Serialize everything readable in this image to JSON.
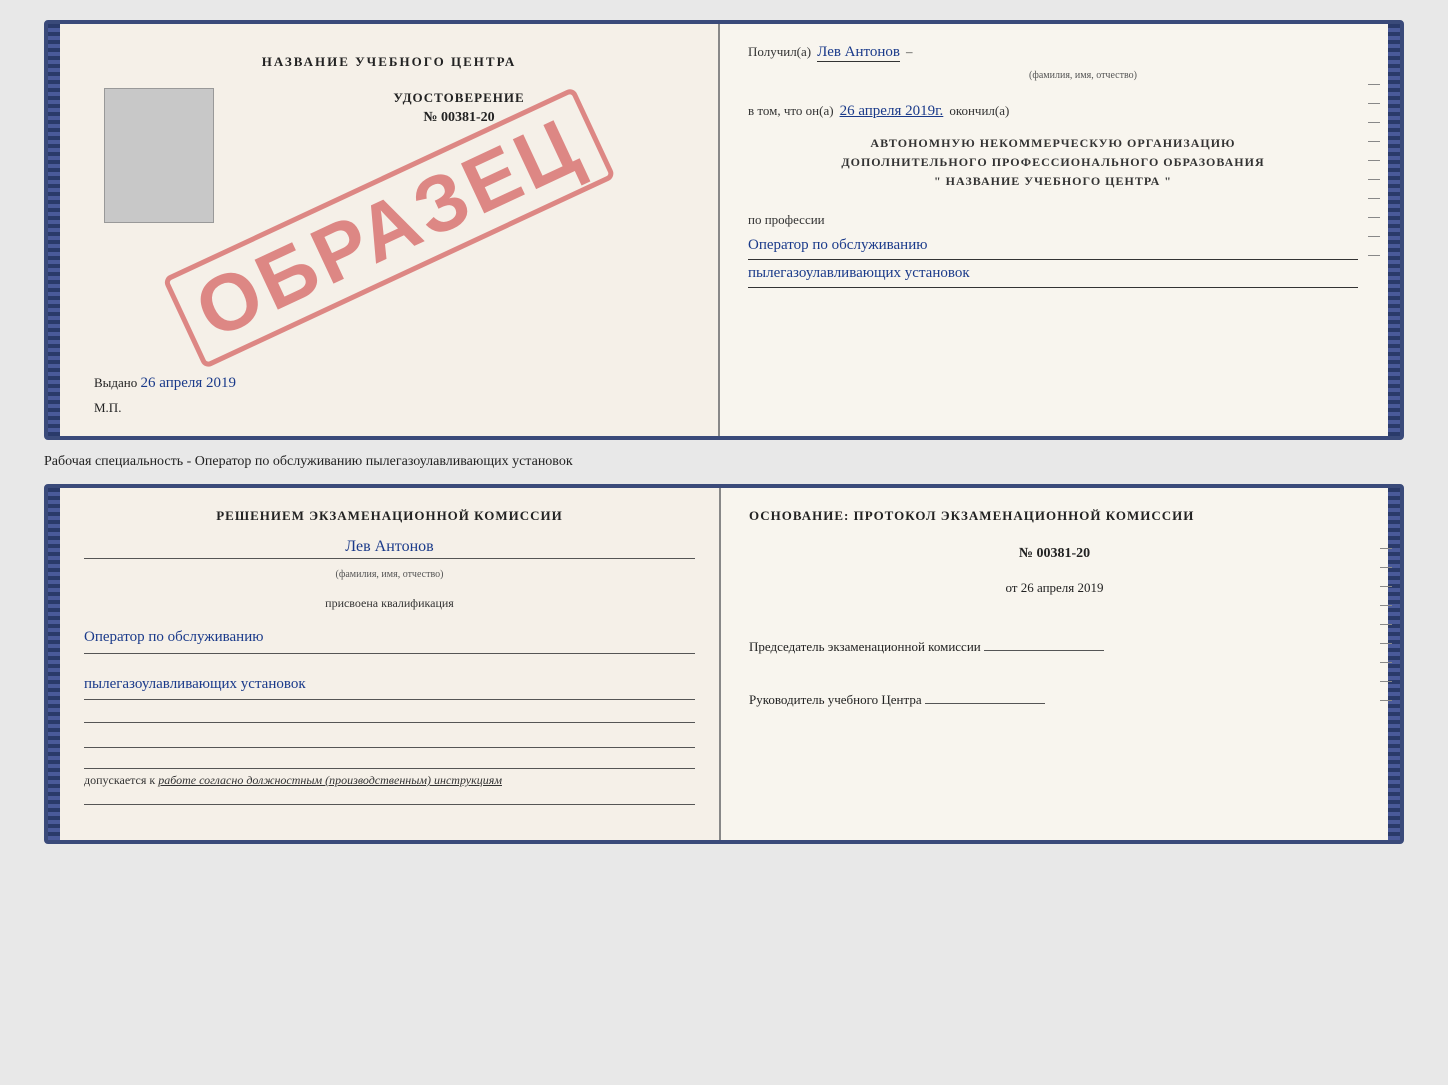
{
  "cert": {
    "left": {
      "title": "НАЗВАНИЕ УЧЕБНОГО ЦЕНТРА",
      "stamp_text": "ОБРАЗЕЦ",
      "udostoverenie_label": "УДОСТОВЕРЕНИЕ",
      "number": "№ 00381-20",
      "vydano_label": "Выдано",
      "vydano_date": "26 апреля 2019",
      "mp_label": "М.П."
    },
    "right": {
      "poluchil_label": "Получил(а)",
      "fio": "Лев Антонов",
      "fio_hint": "(фамилия, имя, отчество)",
      "dash": "–",
      "v_tom_label": "в том, что он(а)",
      "okончил_date": "26 апреля 2019г.",
      "okончил_label": "окончил(а)",
      "org_line1": "АВТОНОМНУЮ НЕКОММЕРЧЕСКУЮ ОРГАНИЗАЦИЮ",
      "org_line2": "ДОПОЛНИТЕЛЬНОГО ПРОФЕССИОНАЛЬНОГО ОБРАЗОВАНИЯ",
      "org_line3": "\"   НАЗВАНИЕ УЧЕБНОГО ЦЕНТРА   \"",
      "po_professii_label": "по профессии",
      "profession_line1": "Оператор по обслуживанию",
      "profession_line2": "пылегазоулавливающих установок"
    }
  },
  "between_text": "Рабочая специальность - Оператор по обслуживанию пылегазоулавливающих установок",
  "bottom": {
    "left": {
      "resheniye_label": "Решением экзаменационной комиссии",
      "fio": "Лев Антонов",
      "fio_hint": "(фамилия, имя, отчество)",
      "prisvoena_label": "присвоена квалификация",
      "kvалif_line1": "Оператор по обслуживанию",
      "kvалif_line2": "пылегазоулавливающих установок",
      "dopuskaetsya_prefix": "допускается к",
      "dopuskaetsya_italic": "работе согласно должностным (производственным) инструкциям"
    },
    "right": {
      "osnovaniye_label": "Основание: протокол экзаменационной комиссии",
      "number": "№ 00381-20",
      "ot_label": "от",
      "ot_date": "26 апреля 2019",
      "predsedatel_label": "Председатель экзаменационной комиссии",
      "rukovoditel_label": "Руководитель учебного Центра"
    }
  }
}
